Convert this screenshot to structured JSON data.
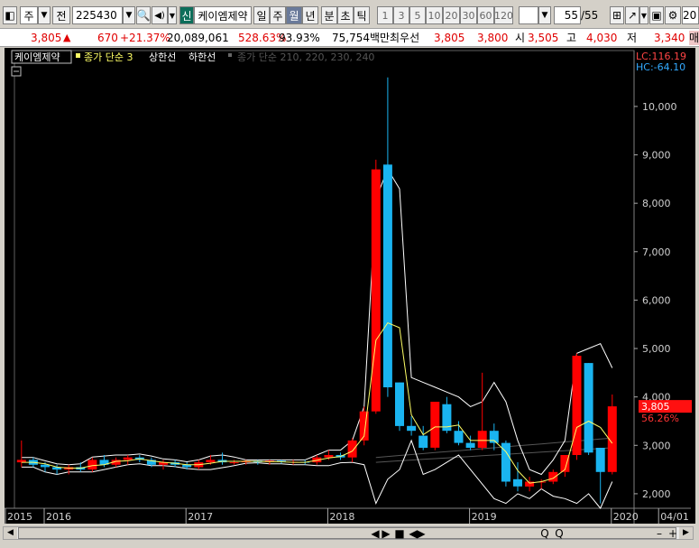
{
  "toolbar": {
    "market_type": "주",
    "prev_label": "전",
    "stock_code": "225430",
    "new_badge": "신",
    "stock_name": "케이엠제약",
    "periods": [
      "일",
      "주",
      "월",
      "년",
      "분",
      "초",
      "틱"
    ],
    "selected_period": "월",
    "intervals": [
      "1",
      "3",
      "5",
      "10",
      "20",
      "30",
      "60",
      "120"
    ],
    "count": "55",
    "count_total": "/55",
    "right_text": "20"
  },
  "quote": {
    "price": "3,805",
    "change": "670",
    "change_pct": "+21.37%",
    "volume": "20,089,061",
    "vol_ratio": "528.63%",
    "ratio2": "93.93%",
    "amount": "75,754백만",
    "best_ask_label": "최우선",
    "best_ask": "3,805",
    "best_bid": "3,800",
    "open_label": "시",
    "open": "3,505",
    "high_label": "고",
    "high": "4,030",
    "low_label": "저",
    "low": "3,340",
    "cut_label": "매"
  },
  "legend": {
    "name": "케이엠제약",
    "ma": "종가 단순 3",
    "upper": "상한선",
    "lower": "하한선",
    "extra": "종가 단순 210, 220, 230, 240"
  },
  "corner": {
    "lc": "LC:116.19",
    "hc": "HC:-64.10"
  },
  "colors": {
    "up": "#ff0000",
    "down": "#1ab4f0",
    "ma": "#ffff66",
    "band": "#ffffff",
    "extra_ma": "#555555"
  },
  "chart_data": {
    "type": "candlestick",
    "ylim": [
      1700,
      10800
    ],
    "y_ticks": [
      2000,
      3000,
      4000,
      5000,
      6000,
      7000,
      8000,
      9000,
      10000
    ],
    "y_tick_labels": [
      "2,000",
      "3,000",
      "4,000",
      "5,000",
      "6,000",
      "7,000",
      "8,000",
      "9,000",
      "10,000"
    ],
    "x_labels": [
      {
        "label": "2015",
        "index": 0
      },
      {
        "label": "2016",
        "index": 2
      },
      {
        "label": "2017",
        "index": 14
      },
      {
        "label": "2018",
        "index": 26
      },
      {
        "label": "2019",
        "index": 38
      },
      {
        "label": "2020",
        "index": 50
      },
      {
        "label": "04/01",
        "index": 54
      }
    ],
    "current_price": 3805,
    "current_price_label": "3,805",
    "current_pct_label": "56.26%",
    "ohlc": [
      [
        2650,
        3100,
        2550,
        2700
      ],
      [
        2700,
        2750,
        2550,
        2600
      ],
      [
        2600,
        2650,
        2450,
        2550
      ],
      [
        2550,
        2600,
        2400,
        2500
      ],
      [
        2500,
        2600,
        2400,
        2550
      ],
      [
        2550,
        2650,
        2450,
        2500
      ],
      [
        2500,
        2750,
        2450,
        2700
      ],
      [
        2700,
        2800,
        2550,
        2600
      ],
      [
        2600,
        2750,
        2550,
        2700
      ],
      [
        2700,
        2800,
        2600,
        2750
      ],
      [
        2750,
        2800,
        2650,
        2700
      ],
      [
        2700,
        2750,
        2550,
        2600
      ],
      [
        2600,
        2700,
        2500,
        2650
      ],
      [
        2650,
        2700,
        2550,
        2600
      ],
      [
        2600,
        2650,
        2500,
        2550
      ],
      [
        2550,
        2700,
        2500,
        2650
      ],
      [
        2650,
        2800,
        2600,
        2700
      ],
      [
        2700,
        2850,
        2600,
        2650
      ],
      [
        2650,
        2700,
        2600,
        2650
      ],
      [
        2650,
        2700,
        2600,
        2680
      ],
      [
        2680,
        2700,
        2600,
        2650
      ],
      [
        2650,
        2700,
        2600,
        2680
      ],
      [
        2680,
        2700,
        2620,
        2650
      ],
      [
        2650,
        2700,
        2600,
        2660
      ],
      [
        2660,
        2700,
        2600,
        2650
      ],
      [
        2650,
        2800,
        2600,
        2750
      ],
      [
        2750,
        2900,
        2700,
        2800
      ],
      [
        2800,
        2850,
        2700,
        2750
      ],
      [
        2750,
        3150,
        2650,
        3100
      ],
      [
        3100,
        3800,
        3000,
        3700
      ],
      [
        3700,
        8900,
        3650,
        8700
      ],
      [
        8800,
        10600,
        4000,
        4200
      ],
      [
        4300,
        4300,
        3300,
        3400
      ],
      [
        3400,
        3600,
        3200,
        3300
      ],
      [
        3200,
        3400,
        2900,
        2950
      ],
      [
        2950,
        3900,
        2900,
        3900
      ],
      [
        3850,
        4000,
        3250,
        3300
      ],
      [
        3300,
        3500,
        3000,
        3050
      ],
      [
        3050,
        3200,
        2900,
        2950
      ],
      [
        2950,
        4500,
        2900,
        3300
      ],
      [
        3300,
        3450,
        2900,
        3050
      ],
      [
        3050,
        3100,
        2150,
        2250
      ],
      [
        2300,
        2650,
        2050,
        2150
      ],
      [
        2150,
        2350,
        2050,
        2250
      ],
      [
        2250,
        2300,
        2100,
        2250
      ],
      [
        2250,
        2500,
        2200,
        2450
      ],
      [
        2450,
        2800,
        2350,
        2800
      ],
      [
        2800,
        4900,
        2700,
        4850
      ],
      [
        4700,
        4700,
        2800,
        2850
      ],
      [
        2950,
        2950,
        1800,
        2450
      ],
      [
        2450,
        4050,
        2400,
        3805
      ]
    ],
    "ma3": [
      2650,
      2650,
      2620,
      2550,
      2530,
      2530,
      2580,
      2600,
      2670,
      2680,
      2720,
      2680,
      2650,
      2630,
      2600,
      2600,
      2630,
      2670,
      2670,
      2670,
      2670,
      2660,
      2660,
      2650,
      2650,
      2690,
      2740,
      2770,
      2880,
      3190,
      5170,
      5530,
      5430,
      3630,
      3220,
      3380,
      3380,
      3420,
      3100,
      3100,
      3100,
      2870,
      2480,
      2220,
      2250,
      2320,
      2500,
      3370,
      3500,
      3370,
      3040
    ],
    "upper": [
      2750,
      2750,
      2680,
      2620,
      2600,
      2620,
      2760,
      2780,
      2800,
      2800,
      2820,
      2780,
      2720,
      2700,
      2660,
      2700,
      2780,
      2800,
      2760,
      2700,
      2700,
      2700,
      2700,
      2700,
      2700,
      2800,
      2900,
      2900,
      3100,
      3800,
      8100,
      8700,
      8300,
      4400,
      4300,
      4200,
      4100,
      4000,
      3800,
      3900,
      4300,
      3900,
      3100,
      2500,
      2400,
      2700,
      3100,
      4900,
      5000,
      5100,
      4600
    ],
    "lower": [
      2550,
      2550,
      2450,
      2400,
      2450,
      2450,
      2450,
      2500,
      2550,
      2600,
      2620,
      2580,
      2580,
      2560,
      2520,
      2500,
      2500,
      2540,
      2580,
      2630,
      2640,
      2620,
      2620,
      2600,
      2600,
      2580,
      2580,
      2640,
      2650,
      2600,
      1800,
      2300,
      2500,
      3100,
      2400,
      2500,
      2650,
      2800,
      2500,
      2200,
      1900,
      1800,
      2000,
      1900,
      2100,
      1950,
      1900,
      1800,
      2000,
      1700,
      2250
    ]
  },
  "controls": [
    "◀",
    "▶",
    "■",
    "◀",
    "▶",
    "Q",
    "Q",
    "–",
    "+"
  ]
}
